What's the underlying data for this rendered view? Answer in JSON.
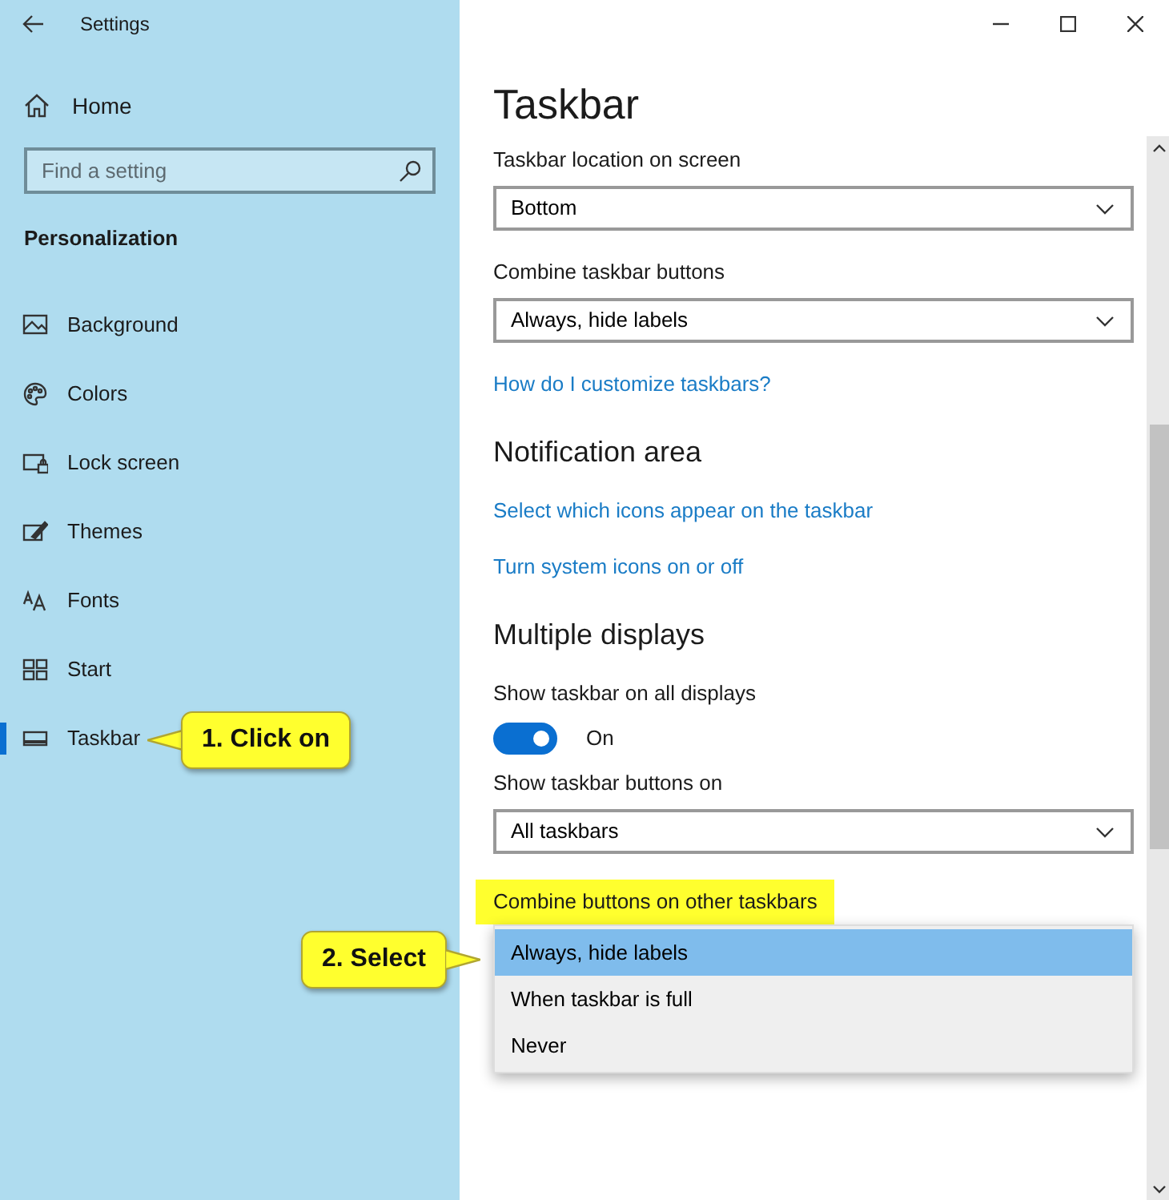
{
  "window": {
    "title": "Settings"
  },
  "sidebar": {
    "home": "Home",
    "search": {
      "placeholder": "Find a setting"
    },
    "section": "Personalization",
    "items": [
      {
        "label": "Background",
        "kind": "background",
        "selected": false
      },
      {
        "label": "Colors",
        "kind": "colors",
        "selected": false
      },
      {
        "label": "Lock screen",
        "kind": "lockscreen",
        "selected": false
      },
      {
        "label": "Themes",
        "kind": "themes",
        "selected": false
      },
      {
        "label": "Fonts",
        "kind": "fonts",
        "selected": false
      },
      {
        "label": "Start",
        "kind": "start",
        "selected": false
      },
      {
        "label": "Taskbar",
        "kind": "taskbar",
        "selected": true,
        "callout": "1. Click on"
      }
    ]
  },
  "content": {
    "title": "Taskbar",
    "items": [
      {
        "kind": "dropdown",
        "label": "Taskbar location on screen",
        "value": "Bottom"
      },
      {
        "kind": "dropdown",
        "label": "Combine taskbar buttons",
        "value": "Always, hide labels"
      },
      {
        "kind": "link",
        "text": "How do I customize taskbars?"
      },
      {
        "kind": "heading",
        "text": "Notification area"
      },
      {
        "kind": "link",
        "text": "Select which icons appear on the taskbar"
      },
      {
        "kind": "link",
        "text": "Turn system icons on or off"
      },
      {
        "kind": "heading",
        "text": "Multiple displays"
      },
      {
        "kind": "toggle",
        "label": "Show taskbar on all displays",
        "on": true,
        "state_text": "On"
      },
      {
        "kind": "dropdown",
        "label": "Show taskbar buttons on",
        "value": "All taskbars"
      },
      {
        "kind": "open_dropdown",
        "label": "Combine buttons on other taskbars",
        "highlighted": true,
        "callout": "2. Select",
        "options": [
          {
            "label": "Always, hide labels",
            "selected": true
          },
          {
            "label": "When taskbar is full",
            "selected": false
          },
          {
            "label": "Never",
            "selected": false
          }
        ]
      }
    ]
  }
}
